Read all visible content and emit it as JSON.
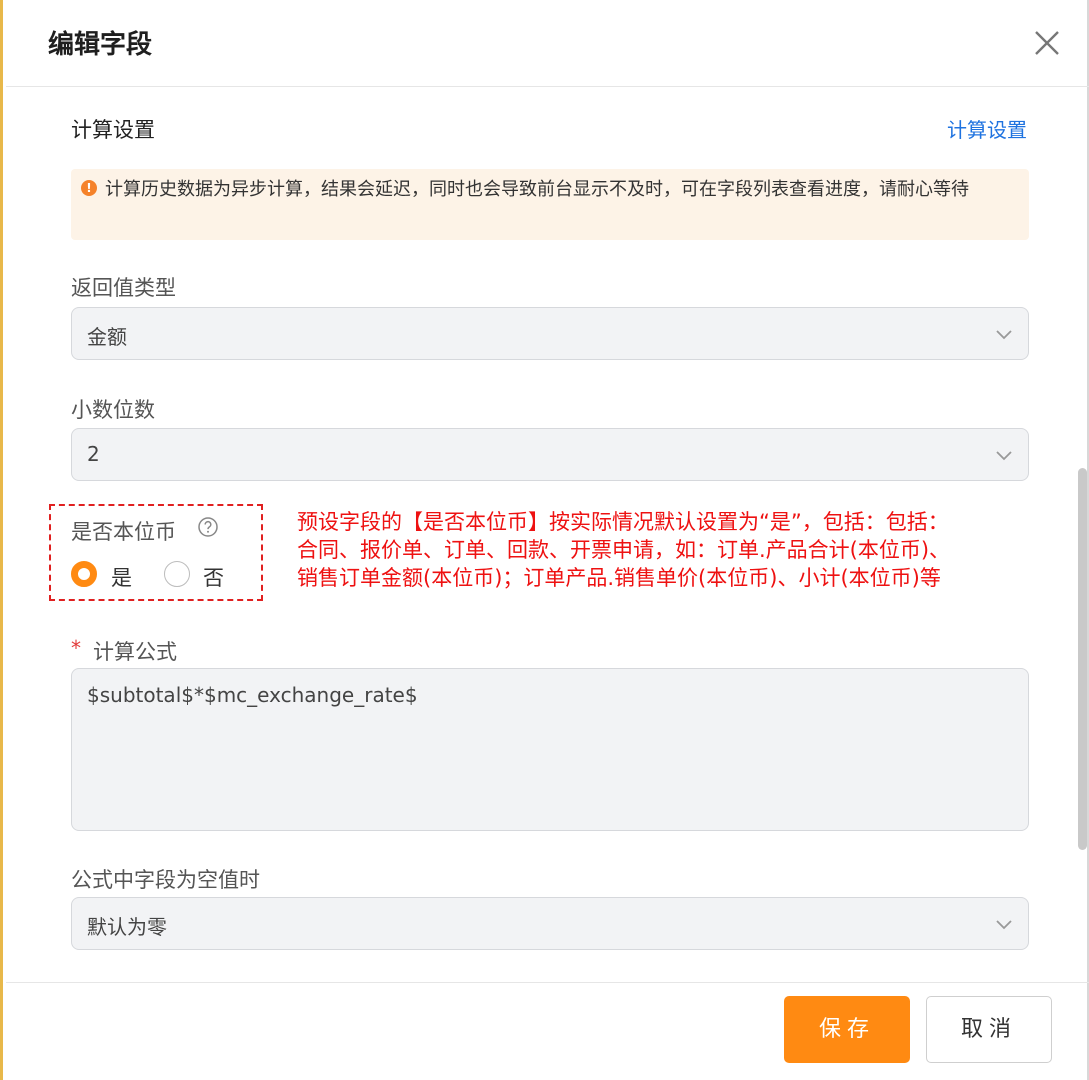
{
  "dialog": {
    "title": "编辑字段"
  },
  "calc_section": {
    "title": "计算设置",
    "link": "计算设置"
  },
  "notice": {
    "text": "计算历史数据为异步计算，结果会延迟，同时也会导致前台显示不及时，可在字段列表查看进度，请耐心等待"
  },
  "return_type": {
    "label": "返回值类型",
    "value": "金额"
  },
  "decimals": {
    "label": "小数位数",
    "value": "2"
  },
  "local_currency": {
    "label": "是否本位币",
    "options": [
      "是",
      "否"
    ],
    "selected": "是"
  },
  "annotation": {
    "text": "预设字段的【是否本位币】按实际情况默认设置为“是”，包括：包括：合同、报价单、订单、回款、开票申请，如：订单.产品合计(本位币)、销售订单金额(本位币)；订单产品.销售单价(本位币)、小计(本位币)等"
  },
  "formula": {
    "required_mark": "*",
    "label": "计算公式",
    "value": "$subtotal$*$mc_exchange_rate$"
  },
  "empty_value": {
    "label": "公式中字段为空值时",
    "value": "默认为零"
  },
  "footer": {
    "save_label": "保存",
    "cancel_label": "取消"
  },
  "colors": {
    "accent": "#ff8a12",
    "link": "#1f73e0",
    "annotation": "#ee1111"
  },
  "icons": {
    "close": "close-icon",
    "notice": "warning-icon",
    "help": "question-circle-icon",
    "select": "chevron-down-icon"
  }
}
